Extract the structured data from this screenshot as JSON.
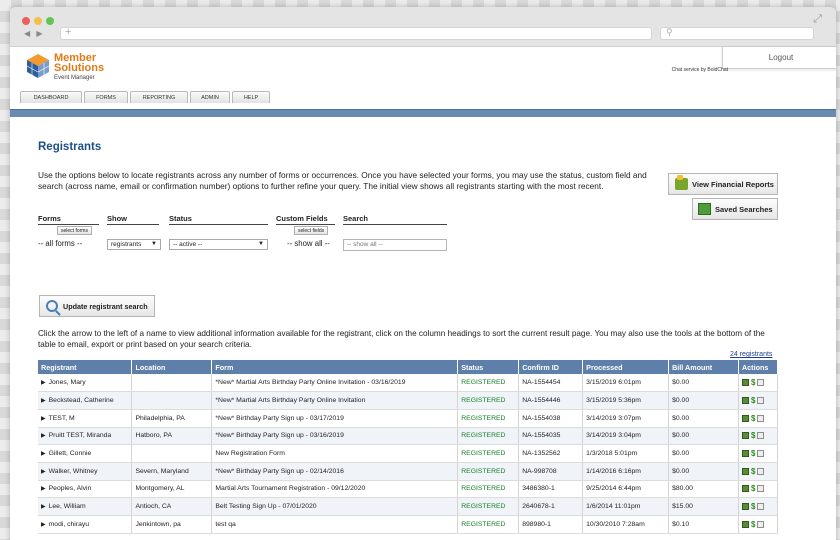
{
  "browser": {
    "address": "",
    "search": ""
  },
  "brand": {
    "line1": "Member",
    "line2": "Solutions",
    "line3": "Event Manager"
  },
  "header": {
    "logout": "Logout",
    "chat_service": "Chat service by BoldChat"
  },
  "tabs": [
    {
      "label": "DASHBOARD"
    },
    {
      "label": "FORMS"
    },
    {
      "label": "REPORTING"
    },
    {
      "label": "ADMIN"
    },
    {
      "label": "HELP"
    }
  ],
  "page": {
    "title": "Registrants",
    "intro": "Use the options below to locate registrants across any number of forms or occurrences. Once you have selected your forms, you may use the status, custom field and search (across name, email or confirmation number) options to further refine your query. The initial view shows all registrants starting with the most recent.",
    "buttons": {
      "financial": "View Financial Reports",
      "saved": "Saved Searches",
      "update": "Update registrant search"
    }
  },
  "filters": {
    "forms": {
      "label": "Forms",
      "button": "select forms",
      "value": "-- all forms --"
    },
    "show": {
      "label": "Show",
      "value": "registrants"
    },
    "status": {
      "label": "Status",
      "value": "-- active --"
    },
    "custom": {
      "label": "Custom Fields",
      "button": "select fields",
      "value": "-- show all --"
    },
    "search": {
      "label": "Search",
      "placeholder": "-- show all --"
    }
  },
  "results": {
    "instruction": "Click the arrow to the left of a name to view additional information available for the registrant, click on the column headings to sort the current result page. You may also use the tools at the bottom of the table to email, export or print based on your search criteria.",
    "count": "24 registrants",
    "columns": [
      "Registrant",
      "Location",
      "Form",
      "Status",
      "Confirm ID",
      "Processed",
      "Bill Amount",
      "Actions"
    ],
    "rows": [
      {
        "name": "Jones, Mary",
        "location": "",
        "form": "*New* Martial Arts Birthday Party Online Invitation - 03/16/2019",
        "status": "REGISTERED",
        "confirm": "NA-1554454",
        "processed": "3/15/2019 6:01pm",
        "amount": "$0.00"
      },
      {
        "name": "Beckstead, Catherine",
        "location": "",
        "form": "*New* Martial Arts Birthday Party Online Invitation",
        "status": "REGISTERED",
        "confirm": "NA-1554446",
        "processed": "3/15/2019 5:36pm",
        "amount": "$0.00"
      },
      {
        "name": "TEST, M",
        "location": "Philadelphia, PA",
        "form": "*New* Birthday Party Sign up - 03/17/2019",
        "status": "REGISTERED",
        "confirm": "NA-1554038",
        "processed": "3/14/2019 3:07pm",
        "amount": "$0.00"
      },
      {
        "name": "Pruitt TEST, Miranda",
        "location": "Hatboro, PA",
        "form": "*New* Birthday Party Sign up - 03/16/2019",
        "status": "REGISTERED",
        "confirm": "NA-1554035",
        "processed": "3/14/2019 3:04pm",
        "amount": "$0.00"
      },
      {
        "name": "Gillett, Connie",
        "location": "",
        "form": "New Registration Form",
        "status": "REGISTERED",
        "confirm": "NA-1352562",
        "processed": "1/3/2018 5:01pm",
        "amount": "$0.00"
      },
      {
        "name": "Walker, Whitney",
        "location": "Severn, Maryland",
        "form": "*New* Birthday Party Sign up - 02/14/2016",
        "status": "REGISTERED",
        "confirm": "NA-998708",
        "processed": "1/14/2016 6:16pm",
        "amount": "$0.00"
      },
      {
        "name": "Peoples, Alvin",
        "location": "Montgomery, AL",
        "form": "Martial Arts Tournament Registration - 09/12/2020",
        "status": "REGISTERED",
        "confirm": "3486380-1",
        "processed": "9/25/2014 6:44pm",
        "amount": "$80.00"
      },
      {
        "name": "Lee, William",
        "location": "Antioch, CA",
        "form": "Belt Testing Sign Up - 07/01/2020",
        "status": "REGISTERED",
        "confirm": "2640678-1",
        "processed": "1/6/2014 11:01pm",
        "amount": "$15.00"
      },
      {
        "name": "modi, chirayu",
        "location": "Jenkintown, pa",
        "form": "test qa",
        "status": "REGISTERED",
        "confirm": "898980-1",
        "processed": "10/30/2010 7:28am",
        "amount": "$0.10"
      }
    ]
  },
  "icons": {
    "row_expand": "triangle-right-icon",
    "edit": "edit-icon",
    "payment": "dollar-icon",
    "email": "envelope-icon"
  },
  "colors": {
    "brand_orange": "#e07b16",
    "title_blue": "#1d4f86",
    "table_header": "#5d7fa9",
    "status_green": "#15802a"
  }
}
